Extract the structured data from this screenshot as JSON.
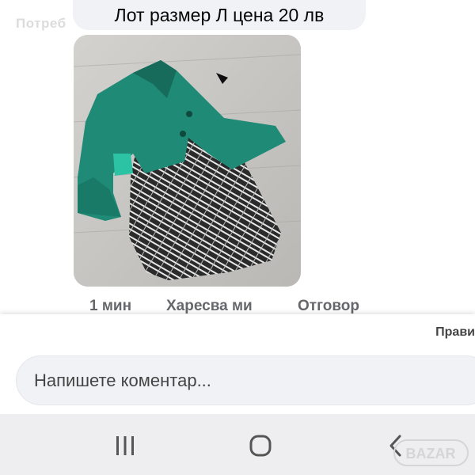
{
  "watermark_top": "Потреб",
  "post": {
    "message": "Лот размер Л цена 20 лв",
    "photo_icon": "dress-jacket-photo"
  },
  "actions": {
    "time": "1 мин",
    "like": "Харесва ми",
    "reply": "Отговор"
  },
  "sheet": {
    "rules_link": "Прави"
  },
  "comment": {
    "placeholder": "Напишете коментар...",
    "value": ""
  },
  "navbar": {
    "recents_icon": "recents-icon",
    "home_icon": "home-icon",
    "back_icon": "back-icon"
  },
  "badge": {
    "text": "BAZAR"
  },
  "colors": {
    "bubble": "#f0f2f5",
    "jacket": "#1f8a76",
    "navbar": "#eeeef0",
    "text_secondary": "#65676b"
  }
}
